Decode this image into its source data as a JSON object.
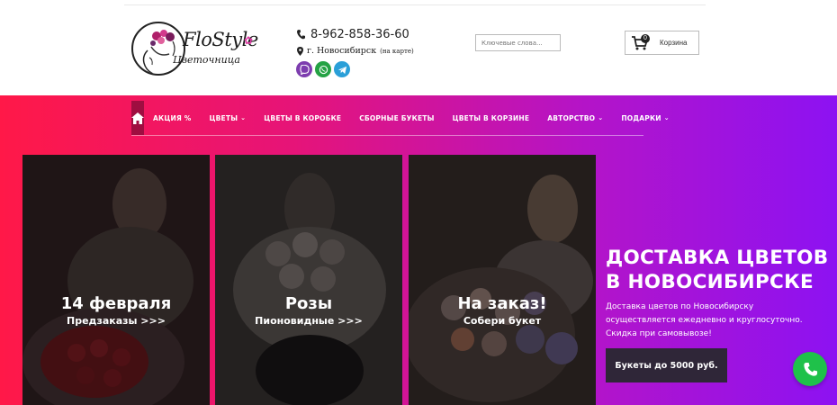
{
  "brand": {
    "name": "FloStyle",
    "subtitle": "Цветочница"
  },
  "contacts": {
    "phone": "8-962-858-36-60",
    "city": "г. Новосибирск",
    "map_link": "(на карте)",
    "messengers": [
      {
        "icon": "viber-icon",
        "color": "#7d3daf"
      },
      {
        "icon": "whatsapp-icon",
        "color": "#25a244"
      },
      {
        "icon": "telegram-icon",
        "color": "#2a9fd8"
      }
    ]
  },
  "search": {
    "placeholder": "Ключевые слова..."
  },
  "cart": {
    "count": "0",
    "label": "Корзина"
  },
  "nav": {
    "items": [
      {
        "label": "АКЦИЯ %",
        "dropdown": false
      },
      {
        "label": "ЦВЕТЫ",
        "dropdown": true
      },
      {
        "label": "ЦВЕТЫ В КОРОБКЕ",
        "dropdown": false
      },
      {
        "label": "СБОРНЫЕ БУКЕТЫ",
        "dropdown": false
      },
      {
        "label": "ЦВЕТЫ В КОРЗИНЕ",
        "dropdown": false
      },
      {
        "label": "АВТОРСТВО",
        "dropdown": true
      },
      {
        "label": "ПОДАРКИ",
        "dropdown": true
      }
    ]
  },
  "cards": [
    {
      "title": "14 февраля",
      "subtitle": "Предзаказы >>>"
    },
    {
      "title": "Розы",
      "subtitle": "Пионовидные >>>"
    },
    {
      "title": "На заказ!",
      "subtitle": "Собери букет"
    }
  ],
  "promo": {
    "title_line1": "ДОСТАВКА ЦВЕТОВ",
    "title_line2": "В НОВОСИБИРСКЕ",
    "text_line1": "Доставка цветов по Новосибирску",
    "text_line2": "осуществляется ежедневно и круглосуточно.",
    "text_line3": "Скидка при самовывозе!",
    "button": "Букеты до 5000 руб."
  },
  "colors": {
    "gradient_start": "#ff1848",
    "gradient_end": "#8d12f2",
    "call_button": "#1fc14a",
    "promo_button": "#2f2638"
  }
}
